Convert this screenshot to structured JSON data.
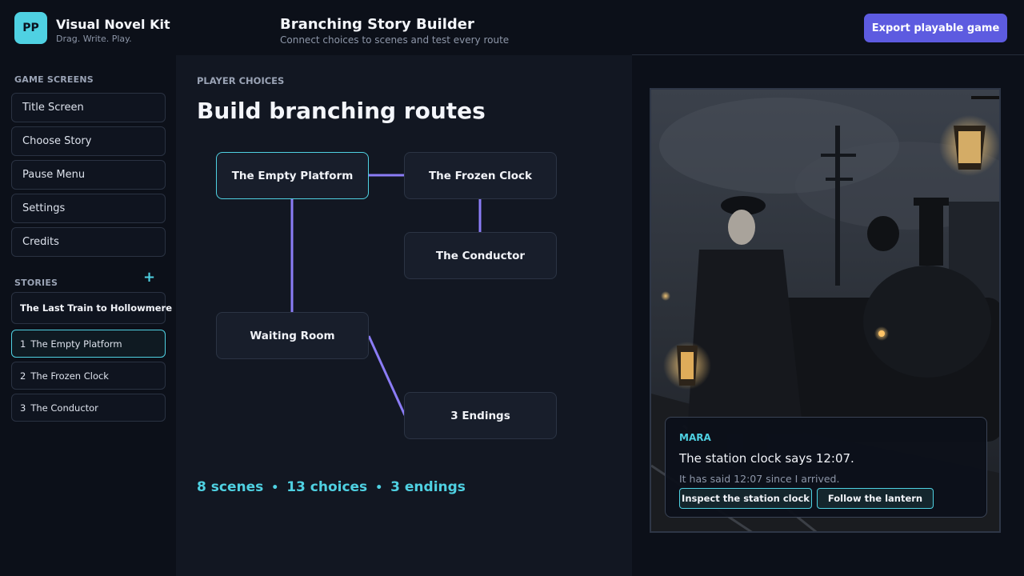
{
  "app": {
    "logo_text": "PP",
    "name": "Visual Novel Kit",
    "tagline": "Drag. Write. Play."
  },
  "header": {
    "title": "Branching Story Builder",
    "subtitle": "Connect choices to scenes and test every route",
    "export_label": "Export playable game"
  },
  "sidebar": {
    "screens_heading": "GAME SCREENS",
    "screens": [
      "Title Screen",
      "Choose Story",
      "Pause Menu",
      "Settings",
      "Credits"
    ],
    "stories_heading": "STORIES",
    "add_icon": "+",
    "story_title": "The Last Train to Hollowmere",
    "scenes": [
      {
        "num": "1",
        "label": "The Empty Platform",
        "active": true
      },
      {
        "num": "2",
        "label": "The Frozen Clock",
        "active": false
      },
      {
        "num": "3",
        "label": "The Conductor",
        "active": false
      }
    ]
  },
  "main": {
    "section_label": "PLAYER CHOICES",
    "section_title": "Build branching routes",
    "nodes": {
      "empty_platform": "The Empty Platform",
      "frozen_clock": "The Frozen Clock",
      "conductor": "The Conductor",
      "waiting_room": "Waiting Room",
      "endings": "3 Endings"
    },
    "stats": {
      "scenes": "8 scenes",
      "choices": "13 choices",
      "endings": "3 endings",
      "separator": "•"
    }
  },
  "preview": {
    "speaker": "MARA",
    "line": "The station clock says 12:07.",
    "subline": "It has said 12:07 since I arrived.",
    "choices": [
      "Inspect the station clock",
      "Follow the lantern"
    ]
  },
  "colors": {
    "accent": "#4fd1e2",
    "primary_button": "#5d5be0",
    "connector": "#8b7cf6",
    "background": "#0c1019"
  }
}
